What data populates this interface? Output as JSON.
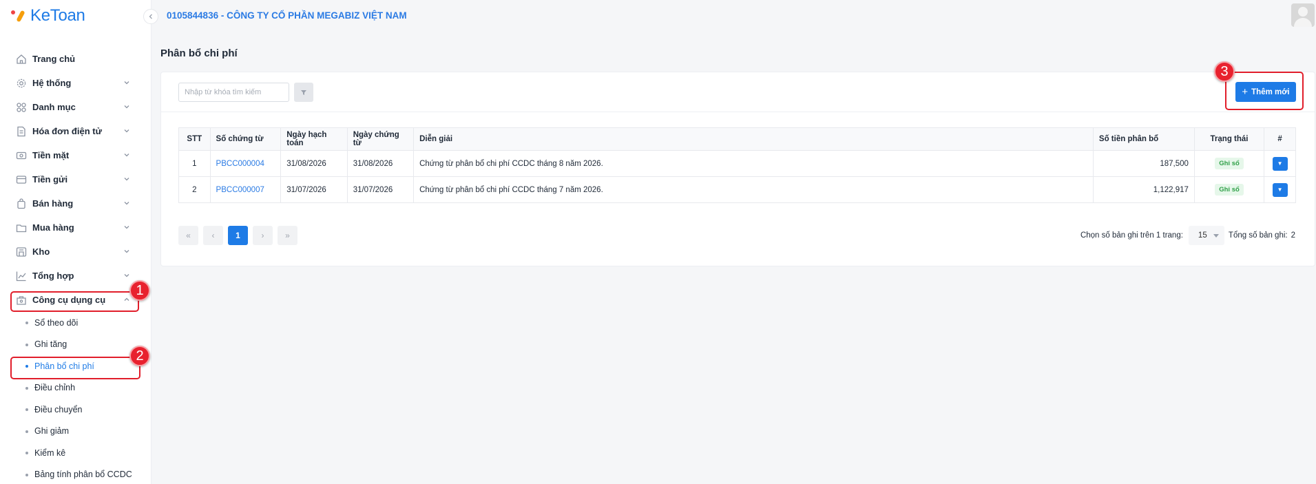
{
  "app": {
    "logo_text": "KeToan"
  },
  "header": {
    "company": "0105844836 - CÔNG TY CỔ PHẦN MEGABIZ VIỆT NAM"
  },
  "sidebar": {
    "items": [
      {
        "label": "Trang chủ",
        "icon": "home-icon"
      },
      {
        "label": "Hệ thống",
        "icon": "gear-icon"
      },
      {
        "label": "Danh mục",
        "icon": "grid-icon"
      },
      {
        "label": "Hóa đơn điện tử",
        "icon": "invoice-icon"
      },
      {
        "label": "Tiền mặt",
        "icon": "cash-icon"
      },
      {
        "label": "Tiền gửi",
        "icon": "bank-card-icon"
      },
      {
        "label": "Bán hàng",
        "icon": "sales-bag-icon"
      },
      {
        "label": "Mua hàng",
        "icon": "purchase-folder-icon"
      },
      {
        "label": "Kho",
        "icon": "warehouse-icon"
      },
      {
        "label": "Tổng hợp",
        "icon": "chart-line-icon"
      },
      {
        "label": "Công cụ dụng cụ",
        "icon": "tools-box-icon"
      }
    ],
    "sub_items": [
      "Sổ theo dõi",
      "Ghi tăng",
      "Phân bổ chi phí",
      "Điều chỉnh",
      "Điều chuyển",
      "Ghi giảm",
      "Kiểm kê",
      "Bảng tính phân bổ CCDC"
    ]
  },
  "annotations": {
    "b1": "1",
    "b2": "2",
    "b3": "3"
  },
  "page": {
    "title": "Phân bổ chi phí"
  },
  "toolbar": {
    "search_placeholder": "Nhập từ khóa tìm kiếm",
    "add_label": "Thêm mới"
  },
  "table": {
    "headers": {
      "stt": "STT",
      "so_chung_tu": "Số chứng từ",
      "ngay_hach_toan": "Ngày hạch toán",
      "ngay_chung_tu": "Ngày chứng từ",
      "dien_giai": "Diễn giải",
      "so_tien": "Số tiền phân bổ",
      "trang_thai": "Trạng thái",
      "action": "#"
    },
    "rows": [
      {
        "stt": "1",
        "so_chung_tu": "PBCC000004",
        "ngay_hach_toan": "31/08/2026",
        "ngay_chung_tu": "31/08/2026",
        "dien_giai": "Chứng từ phân bổ chi phí CCDC tháng 8 năm 2026.",
        "so_tien": "187,500",
        "trang_thai": "Ghi sổ"
      },
      {
        "stt": "2",
        "so_chung_tu": "PBCC000007",
        "ngay_hach_toan": "31/07/2026",
        "ngay_chung_tu": "31/07/2026",
        "dien_giai": "Chứng từ phân bổ chi phí CCDC tháng 7 năm 2026.",
        "so_tien": "1,122,917",
        "trang_thai": "Ghi sổ"
      }
    ]
  },
  "pagination": {
    "current": "1",
    "per_page_label": "Chọn số bản ghi trên 1 trang:",
    "per_page": "15",
    "total_label": "Tổng số bản ghi:",
    "total": "2"
  },
  "colors": {
    "accent": "#1e7be6",
    "highlight": "#e11d2a",
    "status_green": "#2fa047"
  }
}
